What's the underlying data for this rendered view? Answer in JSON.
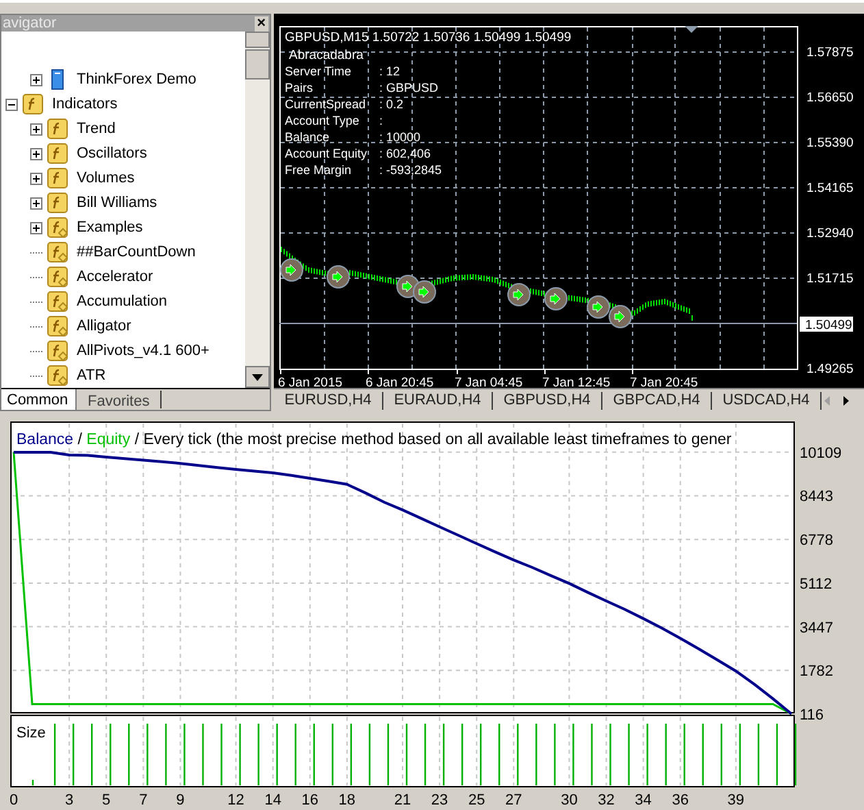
{
  "navigator": {
    "title": "avigator",
    "close": "×",
    "items": [
      {
        "label": "ThinkForex Demo",
        "kind": "account",
        "expanded": false
      },
      {
        "label": "Indicators",
        "kind": "folder",
        "expanded": true,
        "children": [
          {
            "label": "Trend",
            "kind": "folder",
            "expanded": false
          },
          {
            "label": "Oscillators",
            "kind": "folder",
            "expanded": false
          },
          {
            "label": "Volumes",
            "kind": "folder",
            "expanded": false
          },
          {
            "label": "Bill Williams",
            "kind": "folder",
            "expanded": false
          },
          {
            "label": "Examples",
            "kind": "custom-folder",
            "expanded": false
          },
          {
            "label": "##BarCountDown",
            "kind": "indicator"
          },
          {
            "label": "Accelerator",
            "kind": "indicator"
          },
          {
            "label": "Accumulation",
            "kind": "indicator"
          },
          {
            "label": "Alligator",
            "kind": "indicator"
          },
          {
            "label": "AllPivots_v4.1 600+",
            "kind": "indicator"
          },
          {
            "label": "ATR",
            "kind": "indicator"
          }
        ]
      }
    ],
    "tabs": [
      {
        "label": "Common",
        "selected": true
      },
      {
        "label": "Favorites",
        "selected": false
      }
    ]
  },
  "price_chart": {
    "header": "GBPUSD,M15  1.50722 1.50736 1.50499 1.50499",
    "expert": "Abracadabra",
    "info": [
      {
        "label": "Server Time",
        "value": ": 12"
      },
      {
        "label": "Pairs",
        "value": ": GBPUSD"
      },
      {
        "label": "CurrentSpread",
        "value": ": 0.2"
      },
      {
        "label": "Account Type",
        "value": ":"
      },
      {
        "label": "Balance",
        "value": ": 10000"
      },
      {
        "label": "Account Equity",
        "value": ": 602,406"
      },
      {
        "label": "Free Margin",
        "value": ": -593,2845"
      }
    ],
    "price_axis": [
      "1.57875",
      "1.56650",
      "1.55390",
      "1.54165",
      "1.52940",
      "1.51715",
      "1.49265"
    ],
    "current_price": "1.50499",
    "time_axis": [
      "6 Jan 2015",
      "6 Jan 20:45",
      "7 Jan 04:45",
      "7 Jan 12:45",
      "7 Jan 20:45"
    ]
  },
  "chart_tabs": [
    {
      "label": "EURUSD,H4",
      "selected": false
    },
    {
      "label": "EURAUD,H4",
      "selected": false
    },
    {
      "label": "GBPUSD,H4",
      "selected": false
    },
    {
      "label": "GBPCAD,H4",
      "selected": false
    },
    {
      "label": "USDCAD,H4",
      "selected": false
    }
  ],
  "report": {
    "separators": [
      "/",
      "/"
    ],
    "size_label": "Size",
    "chart_data": {
      "type": "line",
      "title": "Every tick (the most precise method based on all available least timeframes to gener",
      "x": [
        0,
        1,
        2,
        3,
        4,
        5,
        6,
        7,
        8,
        9,
        10,
        11,
        12,
        13,
        14,
        15,
        16,
        17,
        18,
        19,
        20,
        21,
        22,
        23,
        24,
        25,
        26,
        27,
        28,
        29,
        30,
        31,
        32,
        33,
        34,
        35,
        36,
        37,
        38,
        39,
        40,
        41,
        42
      ],
      "series": [
        {
          "name": "Balance",
          "color": "#00008b",
          "values": [
            10100,
            10100,
            10100,
            10000,
            9980,
            9920,
            9860,
            9800,
            9740,
            9680,
            9600,
            9520,
            9450,
            9380,
            9320,
            9220,
            9110,
            9000,
            8880,
            8550,
            8200,
            7900,
            7580,
            7260,
            6940,
            6620,
            6300,
            5990,
            5710,
            5400,
            5100,
            4760,
            4430,
            4110,
            3760,
            3400,
            3000,
            2600,
            2180,
            1760,
            1250,
            700,
            120
          ]
        },
        {
          "name": "Equity",
          "color": "#00c000",
          "values": [
            10100,
            500,
            500,
            500,
            500,
            500,
            500,
            500,
            500,
            500,
            500,
            500,
            500,
            500,
            500,
            500,
            500,
            500,
            500,
            500,
            500,
            500,
            500,
            500,
            500,
            500,
            500,
            500,
            500,
            500,
            500,
            500,
            500,
            500,
            500,
            500,
            500,
            500,
            500,
            500,
            500,
            500,
            120
          ]
        }
      ],
      "xlim": [
        0,
        42
      ],
      "ylim": [
        116,
        11200
      ],
      "grid": true,
      "xticks": [
        0,
        3,
        5,
        7,
        9,
        12,
        14,
        16,
        18,
        21,
        23,
        25,
        27,
        30,
        32,
        34,
        36,
        39
      ],
      "yticks": [
        116,
        1782,
        3447,
        5112,
        6778,
        8443,
        10109
      ]
    }
  }
}
